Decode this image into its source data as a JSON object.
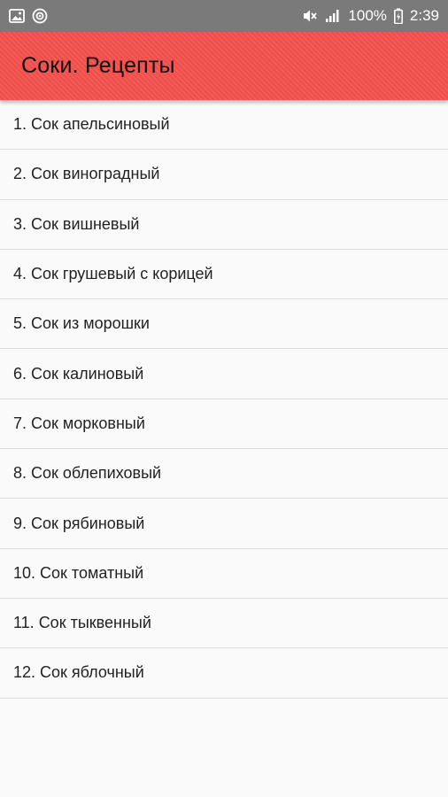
{
  "status_bar": {
    "left_icons": [
      "image-icon",
      "target-icon"
    ],
    "right_icons": [
      "mute-vibrate-icon",
      "signal-icon",
      "battery-icon"
    ],
    "battery_text": "100%",
    "time": "2:39"
  },
  "app_bar": {
    "title": "Соки. Рецепты",
    "color": "#f4504c"
  },
  "recipes": [
    {
      "label": "1. Сок апельсиновый"
    },
    {
      "label": "2. Сок виноградный"
    },
    {
      "label": "3. Сок вишневый"
    },
    {
      "label": "4. Сок грушевый с корицей"
    },
    {
      "label": "5. Сок из морошки"
    },
    {
      "label": "6. Сок калиновый"
    },
    {
      "label": "7. Сок морковный"
    },
    {
      "label": "8. Сок облепиховый"
    },
    {
      "label": "9. Сок рябиновый"
    },
    {
      "label": "10. Сок томатный"
    },
    {
      "label": "11. Сок тыквенный"
    },
    {
      "label": "12. Сок яблочный"
    }
  ]
}
